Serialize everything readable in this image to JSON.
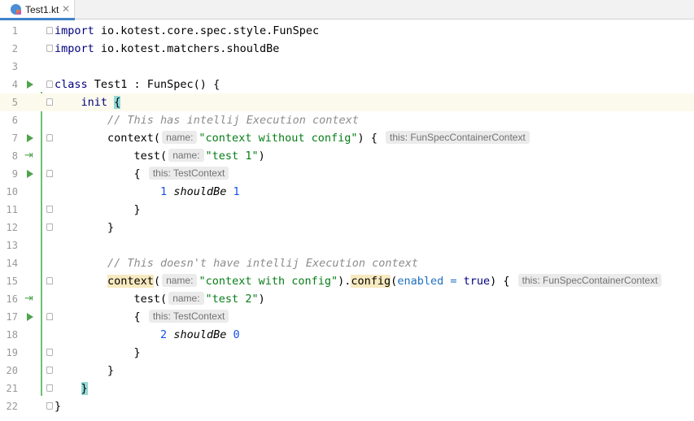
{
  "tab": {
    "filename": "Test1.kt",
    "close": "✕"
  },
  "lines": [
    {
      "n": "1"
    },
    {
      "n": "2"
    },
    {
      "n": "3"
    },
    {
      "n": "4"
    },
    {
      "n": "5"
    },
    {
      "n": "6"
    },
    {
      "n": "7"
    },
    {
      "n": "8"
    },
    {
      "n": "9"
    },
    {
      "n": "10"
    },
    {
      "n": "11"
    },
    {
      "n": "12"
    },
    {
      "n": "13"
    },
    {
      "n": "14"
    },
    {
      "n": "15"
    },
    {
      "n": "16"
    },
    {
      "n": "17"
    },
    {
      "n": "18"
    },
    {
      "n": "19"
    },
    {
      "n": "20"
    },
    {
      "n": "21"
    },
    {
      "n": "22"
    }
  ],
  "code": {
    "l1": {
      "kw": "import",
      "rest": " io.kotest.core.spec.style.FunSpec"
    },
    "l2": {
      "kw": "import",
      "rest": " io.kotest.matchers.shouldBe"
    },
    "l4": {
      "kw": "class",
      "rest": " Test1 : FunSpec() {"
    },
    "l5": {
      "kw": "init",
      "brace": "{"
    },
    "l6": {
      "comment": "// This has intellij Execution context"
    },
    "l7": {
      "fn": "context(",
      "hint": "name:",
      "str": "\"context without config\"",
      "tail": ") {",
      "hint2": "this: FunSpecContainerContext"
    },
    "l8": {
      "fn": "test(",
      "hint": "name:",
      "str": "\"test 1\"",
      "tail": ")"
    },
    "l9": {
      "brace": "{",
      "hint": "this: TestContext"
    },
    "l10": {
      "a": "1",
      "op": "shouldBe",
      "b": "1"
    },
    "l11": {
      "text": "}"
    },
    "l12": {
      "text": "}"
    },
    "l14": {
      "comment": "// This doesn't have intellij Execution context"
    },
    "l15": {
      "fn": "context",
      "paren": "(",
      "hint": "name:",
      "str": "\"context with config\"",
      "mid": ").",
      "fn2": "config",
      "open": "(",
      "named": "enabled",
      "eq": " = ",
      "val": "true",
      "tail": ") {",
      "hint2": "this: FunSpecContainerContext"
    },
    "l16": {
      "fn": "test(",
      "hint": "name:",
      "str": "\"test 2\"",
      "tail": ")"
    },
    "l17": {
      "brace": "{",
      "hint": "this: TestContext"
    },
    "l18": {
      "a": "2",
      "op": "shouldBe",
      "b": "0"
    },
    "l19": {
      "text": "}"
    },
    "l20": {
      "text": "}"
    },
    "l21": {
      "brace": "}"
    },
    "l22": {
      "text": "}"
    }
  }
}
